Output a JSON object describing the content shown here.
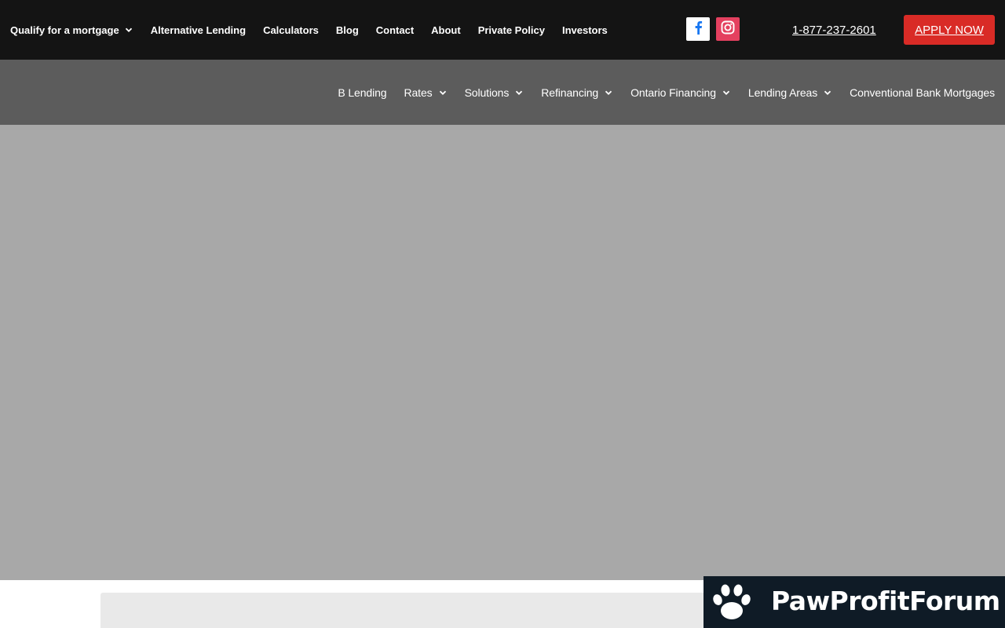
{
  "top_nav": {
    "items": [
      {
        "label": "Qualify for a mortgage",
        "has_dropdown": true
      },
      {
        "label": "Alternative Lending",
        "has_dropdown": false
      },
      {
        "label": "Calculators",
        "has_dropdown": false
      },
      {
        "label": "Blog",
        "has_dropdown": false
      },
      {
        "label": "Contact",
        "has_dropdown": false
      },
      {
        "label": "About",
        "has_dropdown": false
      },
      {
        "label": "Private Policy",
        "has_dropdown": false
      },
      {
        "label": "Investors",
        "has_dropdown": false
      }
    ],
    "social": {
      "facebook_icon": "facebook-icon",
      "instagram_icon": "instagram-icon"
    },
    "phone": "1-877-237-2601",
    "apply_label": "APPLY NOW"
  },
  "secondary_nav": {
    "items": [
      {
        "label": "B Lending",
        "has_dropdown": false
      },
      {
        "label": "Rates",
        "has_dropdown": true
      },
      {
        "label": "Solutions",
        "has_dropdown": true
      },
      {
        "label": "Refinancing",
        "has_dropdown": true
      },
      {
        "label": "Ontario Financing",
        "has_dropdown": true
      },
      {
        "label": "Lending Areas",
        "has_dropdown": true
      },
      {
        "label": "Conventional Bank Mortgages",
        "has_dropdown": false
      }
    ]
  },
  "watermark": {
    "text": "PawProfitForum",
    "icon": "paw-icon"
  },
  "colors": {
    "top_bar_bg": "#141414",
    "secondary_bar_bg": "#5c5c5c",
    "hero_bg": "#a8a8a8",
    "apply_bg": "#d92b26",
    "facebook_blue": "#1877f2",
    "instagram_pink": "#e4405f",
    "watermark_bg": "#0f1b26"
  }
}
